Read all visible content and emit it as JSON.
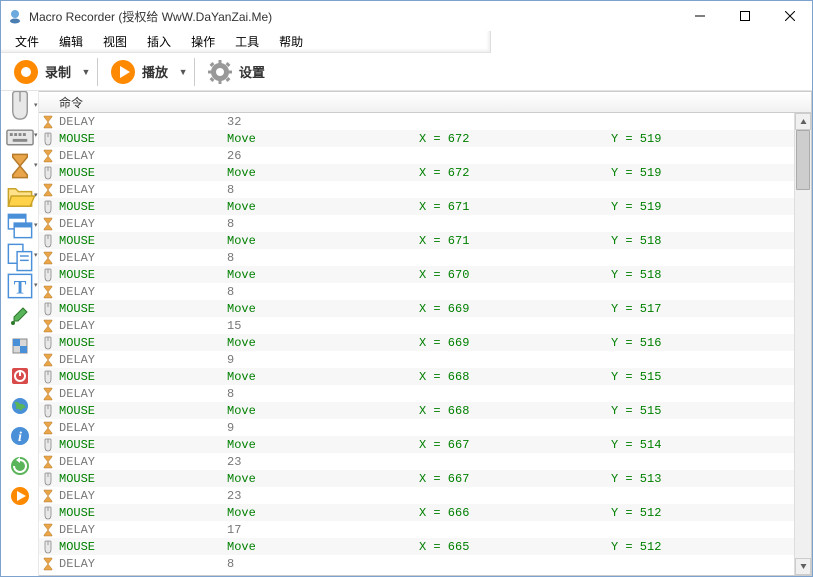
{
  "title": "Macro Recorder (授权给 WwW.DaYanZai.Me)",
  "menus": [
    "文件",
    "编辑",
    "视图",
    "插入",
    "操作",
    "工具",
    "帮助"
  ],
  "toolbar": {
    "record": "录制",
    "play": "播放",
    "settings": "设置"
  },
  "grid": {
    "header": "命令"
  },
  "rows": [
    {
      "type": "DELAY",
      "cmd": "DELAY",
      "c1": "32",
      "c2": "",
      "c3": ""
    },
    {
      "type": "MOUSE",
      "cmd": "MOUSE",
      "c1": "Move",
      "c2": "X = 672",
      "c3": "Y = 519"
    },
    {
      "type": "DELAY",
      "cmd": "DELAY",
      "c1": "26",
      "c2": "",
      "c3": ""
    },
    {
      "type": "MOUSE",
      "cmd": "MOUSE",
      "c1": "Move",
      "c2": "X = 672",
      "c3": "Y = 519"
    },
    {
      "type": "DELAY",
      "cmd": "DELAY",
      "c1": "8",
      "c2": "",
      "c3": ""
    },
    {
      "type": "MOUSE",
      "cmd": "MOUSE",
      "c1": "Move",
      "c2": "X = 671",
      "c3": "Y = 519"
    },
    {
      "type": "DELAY",
      "cmd": "DELAY",
      "c1": "8",
      "c2": "",
      "c3": ""
    },
    {
      "type": "MOUSE",
      "cmd": "MOUSE",
      "c1": "Move",
      "c2": "X = 671",
      "c3": "Y = 518"
    },
    {
      "type": "DELAY",
      "cmd": "DELAY",
      "c1": "8",
      "c2": "",
      "c3": ""
    },
    {
      "type": "MOUSE",
      "cmd": "MOUSE",
      "c1": "Move",
      "c2": "X = 670",
      "c3": "Y = 518"
    },
    {
      "type": "DELAY",
      "cmd": "DELAY",
      "c1": "8",
      "c2": "",
      "c3": ""
    },
    {
      "type": "MOUSE",
      "cmd": "MOUSE",
      "c1": "Move",
      "c2": "X = 669",
      "c3": "Y = 517"
    },
    {
      "type": "DELAY",
      "cmd": "DELAY",
      "c1": "15",
      "c2": "",
      "c3": ""
    },
    {
      "type": "MOUSE",
      "cmd": "MOUSE",
      "c1": "Move",
      "c2": "X = 669",
      "c3": "Y = 516"
    },
    {
      "type": "DELAY",
      "cmd": "DELAY",
      "c1": "9",
      "c2": "",
      "c3": ""
    },
    {
      "type": "MOUSE",
      "cmd": "MOUSE",
      "c1": "Move",
      "c2": "X = 668",
      "c3": "Y = 515"
    },
    {
      "type": "DELAY",
      "cmd": "DELAY",
      "c1": "8",
      "c2": "",
      "c3": ""
    },
    {
      "type": "MOUSE",
      "cmd": "MOUSE",
      "c1": "Move",
      "c2": "X = 668",
      "c3": "Y = 515"
    },
    {
      "type": "DELAY",
      "cmd": "DELAY",
      "c1": "9",
      "c2": "",
      "c3": ""
    },
    {
      "type": "MOUSE",
      "cmd": "MOUSE",
      "c1": "Move",
      "c2": "X = 667",
      "c3": "Y = 514"
    },
    {
      "type": "DELAY",
      "cmd": "DELAY",
      "c1": "23",
      "c2": "",
      "c3": ""
    },
    {
      "type": "MOUSE",
      "cmd": "MOUSE",
      "c1": "Move",
      "c2": "X = 667",
      "c3": "Y = 513"
    },
    {
      "type": "DELAY",
      "cmd": "DELAY",
      "c1": "23",
      "c2": "",
      "c3": ""
    },
    {
      "type": "MOUSE",
      "cmd": "MOUSE",
      "c1": "Move",
      "c2": "X = 666",
      "c3": "Y = 512"
    },
    {
      "type": "DELAY",
      "cmd": "DELAY",
      "c1": "17",
      "c2": "",
      "c3": ""
    },
    {
      "type": "MOUSE",
      "cmd": "MOUSE",
      "c1": "Move",
      "c2": "X = 665",
      "c3": "Y = 512"
    },
    {
      "type": "DELAY",
      "cmd": "DELAY",
      "c1": "8",
      "c2": "",
      "c3": ""
    }
  ],
  "sidebar_icons": [
    {
      "name": "mouse-icon",
      "arrow": true
    },
    {
      "name": "keyboard-icon",
      "arrow": true
    },
    {
      "name": "hourglass-icon",
      "arrow": true
    },
    {
      "name": "open-file-icon",
      "arrow": true
    },
    {
      "name": "windows-icon",
      "arrow": true
    },
    {
      "name": "clipboard-icon",
      "arrow": true
    },
    {
      "name": "text-icon",
      "arrow": true
    },
    {
      "name": "color-picker-icon",
      "arrow": false
    },
    {
      "name": "pixel-icon",
      "arrow": false
    },
    {
      "name": "power-icon",
      "arrow": false
    },
    {
      "name": "globe-icon",
      "arrow": false
    },
    {
      "name": "info-icon",
      "arrow": false
    },
    {
      "name": "refresh-icon",
      "arrow": false
    },
    {
      "name": "play-orange-icon",
      "arrow": false
    }
  ]
}
